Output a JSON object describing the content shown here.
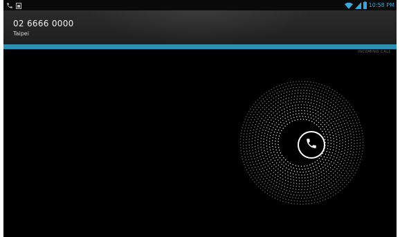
{
  "status_bar": {
    "left_icons": [
      "phone-call-icon",
      "sim-card-icon"
    ],
    "right_icons": [
      "wifi-icon",
      "signal-icon",
      "battery-icon"
    ],
    "time": "10:58 PM",
    "time_color": "#3aa7d8"
  },
  "caller": {
    "number": "02 6666 0000",
    "location": "Taipei"
  },
  "call_state": "INCOMING CALL",
  "accent_color": "#2e8fb0",
  "answer_control": {
    "icon": "phone-icon"
  }
}
